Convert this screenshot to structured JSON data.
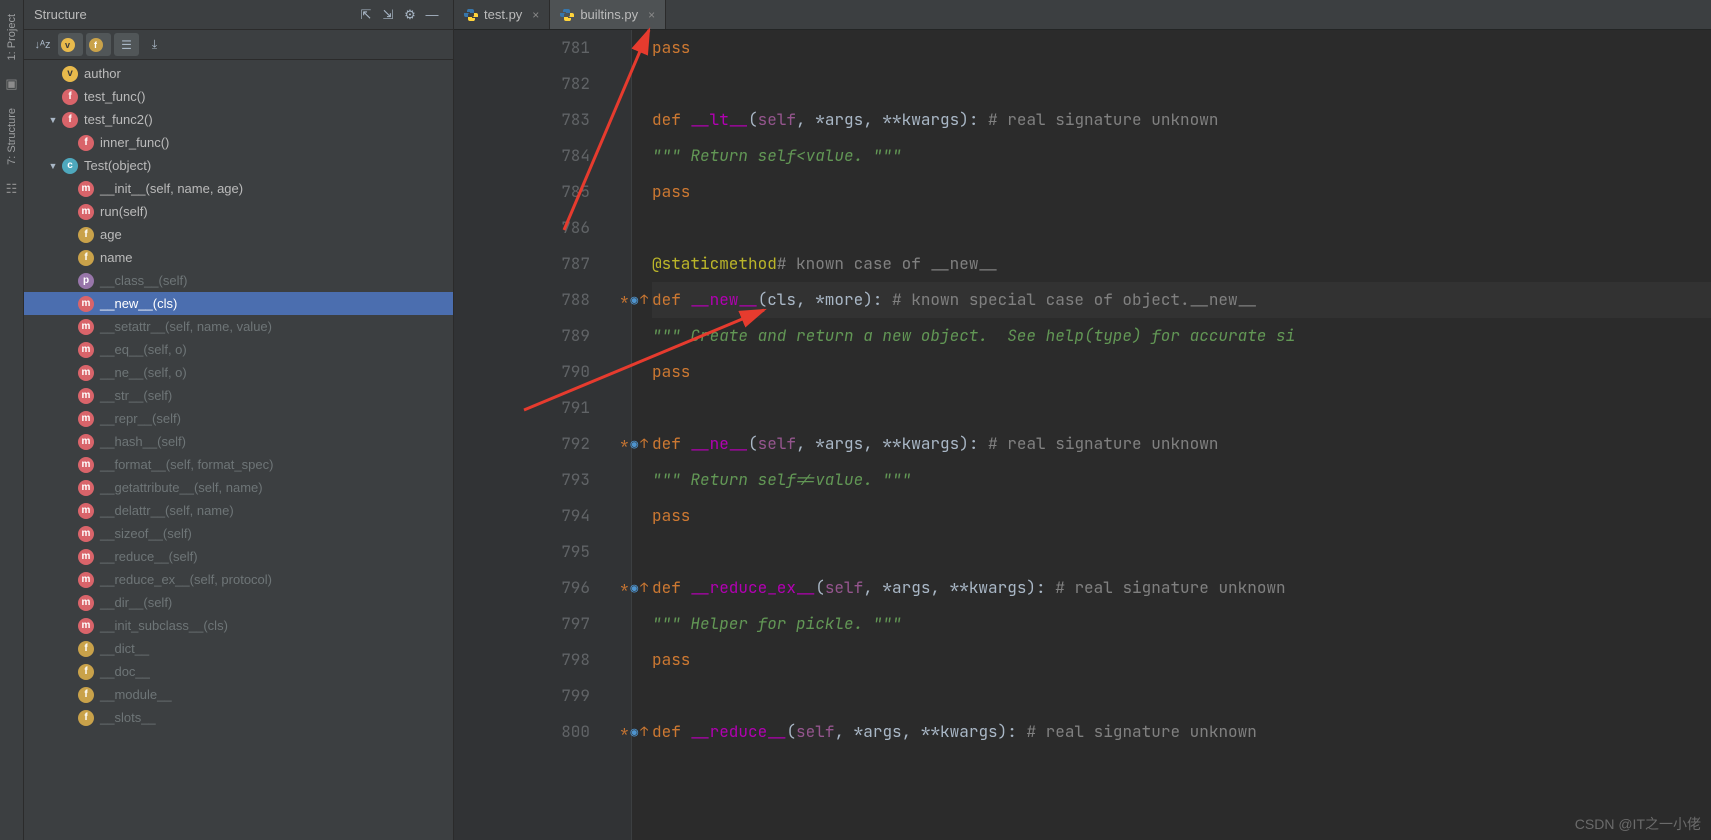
{
  "sidebar": {
    "tabs": [
      "1: Project",
      "7: Structure"
    ]
  },
  "structure": {
    "title": "Structure",
    "tree": [
      {
        "icon": "v",
        "label": "author",
        "indent": 1,
        "dimmed": false
      },
      {
        "icon": "f",
        "label": "test_func()",
        "indent": 1,
        "dimmed": false
      },
      {
        "icon": "f",
        "label": "test_func2()",
        "indent": 1,
        "dimmed": false,
        "expander": "▼"
      },
      {
        "icon": "f",
        "label": "inner_func()",
        "indent": 2,
        "dimmed": false
      },
      {
        "icon": "c",
        "label": "Test(object)",
        "indent": 1,
        "dimmed": false,
        "expander": "▼"
      },
      {
        "icon": "m",
        "label": "__init__(self, name, age)",
        "indent": 2,
        "dimmed": false
      },
      {
        "icon": "m",
        "label": "run(self)",
        "indent": 2,
        "dimmed": false
      },
      {
        "icon": "fd",
        "label": "age",
        "indent": 2,
        "dimmed": false
      },
      {
        "icon": "fd",
        "label": "name",
        "indent": 2,
        "dimmed": false
      },
      {
        "icon": "p",
        "label": "__class__(self)",
        "indent": 2,
        "dimmed": true
      },
      {
        "icon": "m",
        "label": "__new__(cls)",
        "indent": 2,
        "dimmed": false,
        "selected": true
      },
      {
        "icon": "m",
        "label": "__setattr__(self, name, value)",
        "indent": 2,
        "dimmed": true
      },
      {
        "icon": "m",
        "label": "__eq__(self, o)",
        "indent": 2,
        "dimmed": true
      },
      {
        "icon": "m",
        "label": "__ne__(self, o)",
        "indent": 2,
        "dimmed": true
      },
      {
        "icon": "m",
        "label": "__str__(self)",
        "indent": 2,
        "dimmed": true
      },
      {
        "icon": "m",
        "label": "__repr__(self)",
        "indent": 2,
        "dimmed": true
      },
      {
        "icon": "m",
        "label": "__hash__(self)",
        "indent": 2,
        "dimmed": true
      },
      {
        "icon": "m",
        "label": "__format__(self, format_spec)",
        "indent": 2,
        "dimmed": true
      },
      {
        "icon": "m",
        "label": "__getattribute__(self, name)",
        "indent": 2,
        "dimmed": true
      },
      {
        "icon": "m",
        "label": "__delattr__(self, name)",
        "indent": 2,
        "dimmed": true
      },
      {
        "icon": "m",
        "label": "__sizeof__(self)",
        "indent": 2,
        "dimmed": true
      },
      {
        "icon": "m",
        "label": "__reduce__(self)",
        "indent": 2,
        "dimmed": true
      },
      {
        "icon": "m",
        "label": "__reduce_ex__(self, protocol)",
        "indent": 2,
        "dimmed": true
      },
      {
        "icon": "m",
        "label": "__dir__(self)",
        "indent": 2,
        "dimmed": true
      },
      {
        "icon": "m",
        "label": "__init_subclass__(cls)",
        "indent": 2,
        "dimmed": true
      },
      {
        "icon": "fd",
        "label": "__dict__",
        "indent": 2,
        "dimmed": true
      },
      {
        "icon": "fd",
        "label": "__doc__",
        "indent": 2,
        "dimmed": true
      },
      {
        "icon": "fd",
        "label": "__module__",
        "indent": 2,
        "dimmed": true
      },
      {
        "icon": "fd",
        "label": "__slots__",
        "indent": 2,
        "dimmed": true
      }
    ]
  },
  "tabs": [
    {
      "label": "test.py",
      "active": false
    },
    {
      "label": "builtins.py",
      "active": true
    }
  ],
  "code": {
    "start": 781,
    "lines": [
      {
        "n": 781,
        "segs": [
          {
            "t": "            ",
            "c": ""
          },
          {
            "t": "pass",
            "c": "tok-kw"
          }
        ]
      },
      {
        "n": 782,
        "segs": []
      },
      {
        "n": 783,
        "segs": [
          {
            "t": "        ",
            "c": ""
          },
          {
            "t": "def ",
            "c": "tok-kw"
          },
          {
            "t": "__lt__",
            "c": "tok-mag"
          },
          {
            "t": "(",
            "c": "tok-id"
          },
          {
            "t": "self",
            "c": "tok-self"
          },
          {
            "t": ", *args, **kwargs): ",
            "c": "tok-id"
          },
          {
            "t": "# real signature unknown",
            "c": "tok-com"
          }
        ]
      },
      {
        "n": 784,
        "segs": [
          {
            "t": "            ",
            "c": ""
          },
          {
            "t": "\"\"\" Return self<value. \"\"\"",
            "c": "tok-str"
          }
        ]
      },
      {
        "n": 785,
        "segs": [
          {
            "t": "            ",
            "c": ""
          },
          {
            "t": "pass",
            "c": "tok-kw"
          }
        ]
      },
      {
        "n": 786,
        "segs": []
      },
      {
        "n": 787,
        "segs": [
          {
            "t": "        ",
            "c": ""
          },
          {
            "t": "@staticmethod",
            "c": "tok-dec"
          },
          {
            "t": " ",
            "c": ""
          },
          {
            "t": "# known case of __new__",
            "c": "tok-com"
          }
        ]
      },
      {
        "n": 788,
        "hl": true,
        "marks": "*◎↑",
        "segs": [
          {
            "t": "        ",
            "c": ""
          },
          {
            "t": "def ",
            "c": "tok-kw"
          },
          {
            "t": "__new__",
            "c": "tok-mag"
          },
          {
            "t": "(cls, *more): ",
            "c": "tok-id"
          },
          {
            "t": "# known special case of object.__new__",
            "c": "tok-com"
          }
        ]
      },
      {
        "n": 789,
        "segs": [
          {
            "t": "            ",
            "c": ""
          },
          {
            "t": "\"\"\" Create and return a new object.  See help(type) for accurate si",
            "c": "tok-str"
          }
        ]
      },
      {
        "n": 790,
        "segs": [
          {
            "t": "            ",
            "c": ""
          },
          {
            "t": "pass",
            "c": "tok-kw"
          }
        ]
      },
      {
        "n": 791,
        "segs": []
      },
      {
        "n": 792,
        "marks": "*◎↑",
        "segs": [
          {
            "t": "        ",
            "c": ""
          },
          {
            "t": "def ",
            "c": "tok-kw"
          },
          {
            "t": "__ne__",
            "c": "tok-mag"
          },
          {
            "t": "(",
            "c": "tok-id"
          },
          {
            "t": "self",
            "c": "tok-self"
          },
          {
            "t": ", *args, **kwargs): ",
            "c": "tok-id"
          },
          {
            "t": "# real signature unknown",
            "c": "tok-com"
          }
        ]
      },
      {
        "n": 793,
        "segs": [
          {
            "t": "            ",
            "c": ""
          },
          {
            "t": "\"\"\" Return self!=value. \"\"\"",
            "c": "tok-str"
          }
        ]
      },
      {
        "n": 794,
        "segs": [
          {
            "t": "            ",
            "c": ""
          },
          {
            "t": "pass",
            "c": "tok-kw"
          }
        ]
      },
      {
        "n": 795,
        "segs": []
      },
      {
        "n": 796,
        "marks": "*◎↑",
        "segs": [
          {
            "t": "        ",
            "c": ""
          },
          {
            "t": "def ",
            "c": "tok-kw"
          },
          {
            "t": "__reduce_ex__",
            "c": "tok-mag"
          },
          {
            "t": "(",
            "c": "tok-id"
          },
          {
            "t": "self",
            "c": "tok-self"
          },
          {
            "t": ", *args, **kwargs): ",
            "c": "tok-id"
          },
          {
            "t": "# real signature unknown",
            "c": "tok-com"
          }
        ]
      },
      {
        "n": 797,
        "segs": [
          {
            "t": "            ",
            "c": ""
          },
          {
            "t": "\"\"\" Helper for pickle. \"\"\"",
            "c": "tok-str"
          }
        ]
      },
      {
        "n": 798,
        "segs": [
          {
            "t": "            ",
            "c": ""
          },
          {
            "t": "pass",
            "c": "tok-kw"
          }
        ]
      },
      {
        "n": 799,
        "segs": []
      },
      {
        "n": 800,
        "marks": "*◎↑",
        "segs": [
          {
            "t": "        ",
            "c": ""
          },
          {
            "t": "def ",
            "c": "tok-kw"
          },
          {
            "t": "__reduce__",
            "c": "tok-mag"
          },
          {
            "t": "(",
            "c": "tok-id"
          },
          {
            "t": "self",
            "c": "tok-self"
          },
          {
            "t": ", *args, **kwargs): ",
            "c": "tok-id"
          },
          {
            "t": "# real signature unknown",
            "c": "tok-com"
          }
        ]
      }
    ]
  },
  "watermark": "CSDN @IT之一小佬",
  "icons": {
    "settings": "⚙",
    "hide": "—",
    "collapse": "⇱",
    "expand": "⇲"
  }
}
